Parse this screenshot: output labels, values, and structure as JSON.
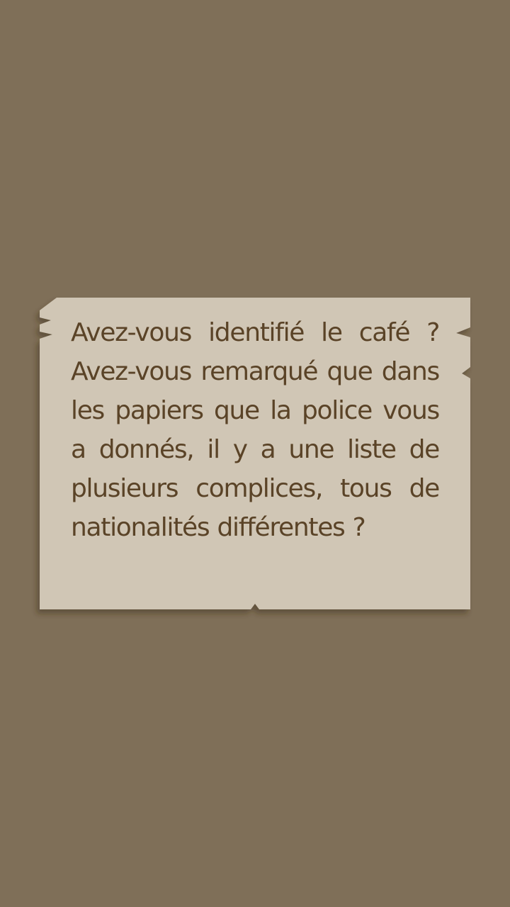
{
  "note": {
    "text": "Avez-vous identifié le café ? Avez-vous remarqué que dans les papiers que la police vous a donnés, il y a une liste de plusieurs complices, tous de nationalités différentes ?"
  },
  "colors": {
    "background": "#7f6f58",
    "paper": "#d0c6b5",
    "ink": "#5a4327"
  }
}
